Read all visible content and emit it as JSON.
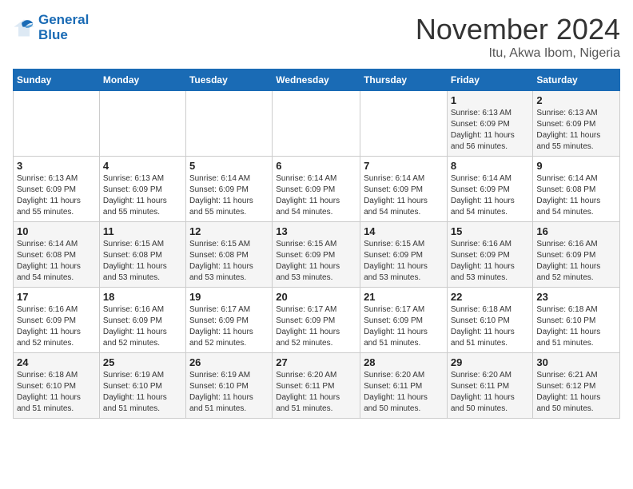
{
  "logo": {
    "line1": "General",
    "line2": "Blue"
  },
  "title": "November 2024",
  "location": "Itu, Akwa Ibom, Nigeria",
  "days_header": [
    "Sunday",
    "Monday",
    "Tuesday",
    "Wednesday",
    "Thursday",
    "Friday",
    "Saturday"
  ],
  "weeks": [
    [
      {
        "day": "",
        "info": ""
      },
      {
        "day": "",
        "info": ""
      },
      {
        "day": "",
        "info": ""
      },
      {
        "day": "",
        "info": ""
      },
      {
        "day": "",
        "info": ""
      },
      {
        "day": "1",
        "info": "Sunrise: 6:13 AM\nSunset: 6:09 PM\nDaylight: 11 hours\nand 56 minutes."
      },
      {
        "day": "2",
        "info": "Sunrise: 6:13 AM\nSunset: 6:09 PM\nDaylight: 11 hours\nand 55 minutes."
      }
    ],
    [
      {
        "day": "3",
        "info": "Sunrise: 6:13 AM\nSunset: 6:09 PM\nDaylight: 11 hours\nand 55 minutes."
      },
      {
        "day": "4",
        "info": "Sunrise: 6:13 AM\nSunset: 6:09 PM\nDaylight: 11 hours\nand 55 minutes."
      },
      {
        "day": "5",
        "info": "Sunrise: 6:14 AM\nSunset: 6:09 PM\nDaylight: 11 hours\nand 55 minutes."
      },
      {
        "day": "6",
        "info": "Sunrise: 6:14 AM\nSunset: 6:09 PM\nDaylight: 11 hours\nand 54 minutes."
      },
      {
        "day": "7",
        "info": "Sunrise: 6:14 AM\nSunset: 6:09 PM\nDaylight: 11 hours\nand 54 minutes."
      },
      {
        "day": "8",
        "info": "Sunrise: 6:14 AM\nSunset: 6:09 PM\nDaylight: 11 hours\nand 54 minutes."
      },
      {
        "day": "9",
        "info": "Sunrise: 6:14 AM\nSunset: 6:08 PM\nDaylight: 11 hours\nand 54 minutes."
      }
    ],
    [
      {
        "day": "10",
        "info": "Sunrise: 6:14 AM\nSunset: 6:08 PM\nDaylight: 11 hours\nand 54 minutes."
      },
      {
        "day": "11",
        "info": "Sunrise: 6:15 AM\nSunset: 6:08 PM\nDaylight: 11 hours\nand 53 minutes."
      },
      {
        "day": "12",
        "info": "Sunrise: 6:15 AM\nSunset: 6:08 PM\nDaylight: 11 hours\nand 53 minutes."
      },
      {
        "day": "13",
        "info": "Sunrise: 6:15 AM\nSunset: 6:09 PM\nDaylight: 11 hours\nand 53 minutes."
      },
      {
        "day": "14",
        "info": "Sunrise: 6:15 AM\nSunset: 6:09 PM\nDaylight: 11 hours\nand 53 minutes."
      },
      {
        "day": "15",
        "info": "Sunrise: 6:16 AM\nSunset: 6:09 PM\nDaylight: 11 hours\nand 53 minutes."
      },
      {
        "day": "16",
        "info": "Sunrise: 6:16 AM\nSunset: 6:09 PM\nDaylight: 11 hours\nand 52 minutes."
      }
    ],
    [
      {
        "day": "17",
        "info": "Sunrise: 6:16 AM\nSunset: 6:09 PM\nDaylight: 11 hours\nand 52 minutes."
      },
      {
        "day": "18",
        "info": "Sunrise: 6:16 AM\nSunset: 6:09 PM\nDaylight: 11 hours\nand 52 minutes."
      },
      {
        "day": "19",
        "info": "Sunrise: 6:17 AM\nSunset: 6:09 PM\nDaylight: 11 hours\nand 52 minutes."
      },
      {
        "day": "20",
        "info": "Sunrise: 6:17 AM\nSunset: 6:09 PM\nDaylight: 11 hours\nand 52 minutes."
      },
      {
        "day": "21",
        "info": "Sunrise: 6:17 AM\nSunset: 6:09 PM\nDaylight: 11 hours\nand 51 minutes."
      },
      {
        "day": "22",
        "info": "Sunrise: 6:18 AM\nSunset: 6:10 PM\nDaylight: 11 hours\nand 51 minutes."
      },
      {
        "day": "23",
        "info": "Sunrise: 6:18 AM\nSunset: 6:10 PM\nDaylight: 11 hours\nand 51 minutes."
      }
    ],
    [
      {
        "day": "24",
        "info": "Sunrise: 6:18 AM\nSunset: 6:10 PM\nDaylight: 11 hours\nand 51 minutes."
      },
      {
        "day": "25",
        "info": "Sunrise: 6:19 AM\nSunset: 6:10 PM\nDaylight: 11 hours\nand 51 minutes."
      },
      {
        "day": "26",
        "info": "Sunrise: 6:19 AM\nSunset: 6:10 PM\nDaylight: 11 hours\nand 51 minutes."
      },
      {
        "day": "27",
        "info": "Sunrise: 6:20 AM\nSunset: 6:11 PM\nDaylight: 11 hours\nand 51 minutes."
      },
      {
        "day": "28",
        "info": "Sunrise: 6:20 AM\nSunset: 6:11 PM\nDaylight: 11 hours\nand 50 minutes."
      },
      {
        "day": "29",
        "info": "Sunrise: 6:20 AM\nSunset: 6:11 PM\nDaylight: 11 hours\nand 50 minutes."
      },
      {
        "day": "30",
        "info": "Sunrise: 6:21 AM\nSunset: 6:12 PM\nDaylight: 11 hours\nand 50 minutes."
      }
    ]
  ]
}
